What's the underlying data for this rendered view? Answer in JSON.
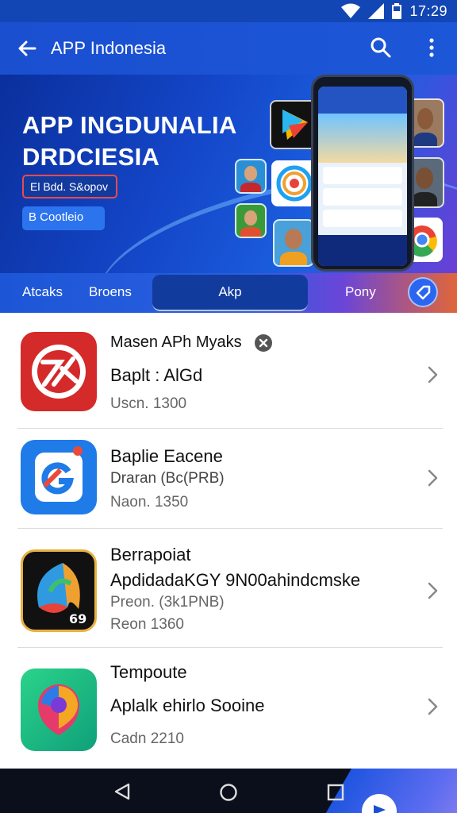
{
  "status_bar": {
    "time": "17:29"
  },
  "app_bar": {
    "title": "APP Indonesia"
  },
  "banner": {
    "headline_line1": "APP INGDUNALIA",
    "headline_line2": "DRDCIESIA",
    "tag1": "El Bdd. S&opov",
    "tag2": "B Cootleio"
  },
  "tabs": {
    "tab1": "Atcaks",
    "tab2": "Broens",
    "tab_active": "Akp",
    "tab4": "Pony"
  },
  "list": {
    "items": [
      {
        "line1": "Masen APh Myaks",
        "line2": "Baplt : AlGd",
        "line3": "Uscn. 1300",
        "has_badge": true
      },
      {
        "line1": "Baplie Eacene",
        "line2": "Draran (Bc(PRB)",
        "line3": "Naon. 1350"
      },
      {
        "line1": "Berrapoiat",
        "line2": "ApdidadaKGY 9N00ahindcmske",
        "line3": "Preon. (3k1PNB)",
        "line4": "Reon 1360"
      },
      {
        "line1": "Tempoute",
        "line2": "Aplalk ehirlo Sooine",
        "line3": "Cadn 2210"
      }
    ]
  },
  "colors": {
    "primary": "#1a4fd0",
    "banner_dark": "#0a2f9c",
    "icon_red": "#d42a2a",
    "icon_blue": "#1f7be8"
  },
  "icons": [
    "wifi-icon",
    "signal-icon",
    "battery-icon",
    "back-arrow-icon",
    "search-icon",
    "more-vert-icon",
    "close-badge-icon",
    "chevron-right-icon",
    "nav-back-icon",
    "nav-home-icon",
    "nav-recents-icon"
  ]
}
